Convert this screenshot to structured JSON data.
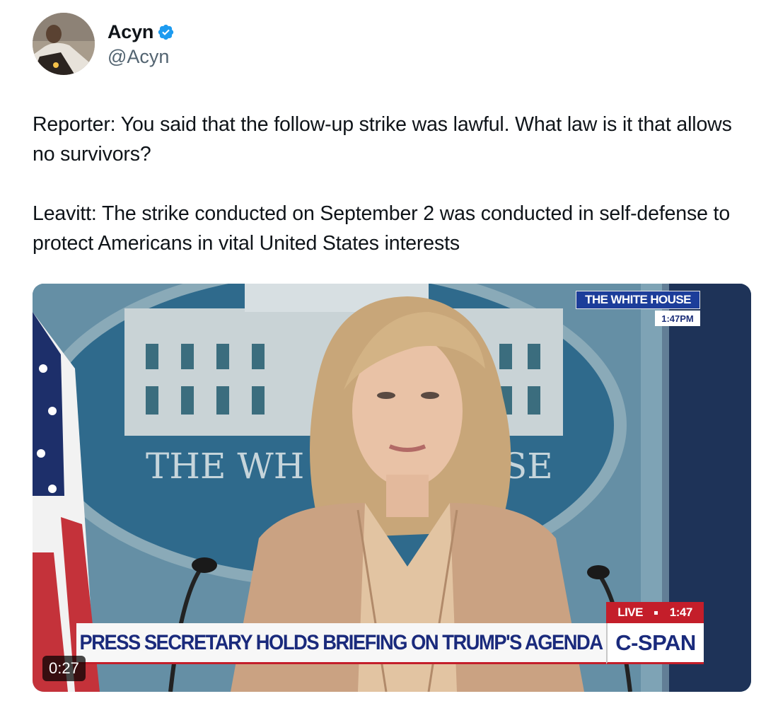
{
  "author": {
    "display_name": "Acyn",
    "handle": "@Acyn",
    "verified_icon": "verified-badge-icon",
    "verified_color": "#1d9bf0"
  },
  "tweet": {
    "paragraphs": [
      "Reporter: You said that the follow-up strike was lawful. What law is it that allows no survivors?",
      "Leavitt: The strike conducted on September 2 was conducted in self-defense to protect Americans in vital United States interests"
    ]
  },
  "video": {
    "backdrop_text_left": "THE WH",
    "backdrop_text_right": "SE",
    "location_banner": "THE WHITE HOUSE",
    "location_time": "1:47PM",
    "live_label": "LIVE",
    "live_time": "1:47",
    "chyron": "PRESS SECRETARY HOLDS BRIEFING ON TRUMP'S AGENDA",
    "network": "C-SPAN",
    "duration": "0:27",
    "colors": {
      "cspan_blue": "#1a2a7c",
      "live_red": "#c41e2a",
      "backdrop_blue": "#2f6a8c"
    }
  }
}
